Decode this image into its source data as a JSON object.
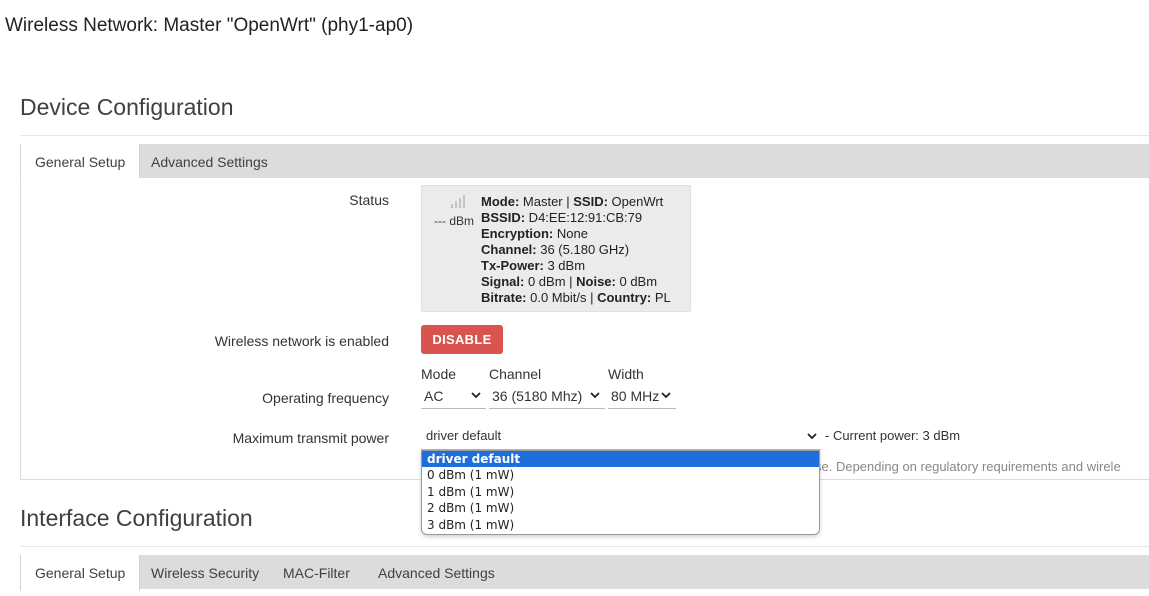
{
  "page": {
    "title": "Wireless Network: Master \"OpenWrt\" (phy1-ap0)"
  },
  "device_config": {
    "heading": "Device Configuration",
    "tabs": [
      {
        "label": "General Setup",
        "active": true
      },
      {
        "label": "Advanced Settings",
        "active": false
      }
    ],
    "status": {
      "label": "Status",
      "signal_text": "--- dBm",
      "mode_key": "Mode:",
      "mode_val": " Master | ",
      "ssid_key": "SSID:",
      "ssid_val": " OpenWrt",
      "bssid_key": "BSSID:",
      "bssid_val": " D4:EE:12:91:CB:79",
      "enc_key": "Encryption:",
      "enc_val": " None",
      "channel_key": "Channel:",
      "channel_val": " 36 (5.180 GHz)",
      "txpower_key": "Tx-Power:",
      "txpower_val": " 3 dBm",
      "signal_key": "Signal:",
      "signal_val": " 0 dBm | ",
      "noise_key": "Noise:",
      "noise_val": " 0 dBm",
      "bitrate_key": "Bitrate:",
      "bitrate_val": " 0.0 Mbit/s | ",
      "country_key": "Country:",
      "country_val": " PL"
    },
    "enabled": {
      "label": "Wireless network is enabled",
      "button": "DISABLE",
      "button_color": "#d9534f"
    },
    "frequency": {
      "label": "Operating frequency",
      "mode_label": "Mode",
      "mode_value": "AC",
      "channel_label": "Channel",
      "channel_value": "36 (5180 Mhz)",
      "width_label": "Width",
      "width_value": "80 MHz"
    },
    "tx_power": {
      "label": "Maximum transmit power",
      "selected": "driver default",
      "suffix": "- Current power: 3 dBm",
      "hint": "se. Depending on regulatory requirements and wirele",
      "options": [
        "driver default",
        "0 dBm (1 mW)",
        "1 dBm (1 mW)",
        "2 dBm (1 mW)",
        "3 dBm (1 mW)"
      ]
    }
  },
  "interface_config": {
    "heading": "Interface Configuration",
    "tabs": [
      {
        "label": "General Setup",
        "active": true
      },
      {
        "label": "Wireless Security",
        "active": false
      },
      {
        "label": "MAC-Filter",
        "active": false
      },
      {
        "label": "Advanced Settings",
        "active": false
      }
    ]
  },
  "colors": {
    "accent_selected": "#1e6fd9",
    "tabbar": "#dcdcdc"
  },
  "icons": {
    "signal": "signal-bars-icon",
    "chevron": "chevron-down-icon"
  }
}
